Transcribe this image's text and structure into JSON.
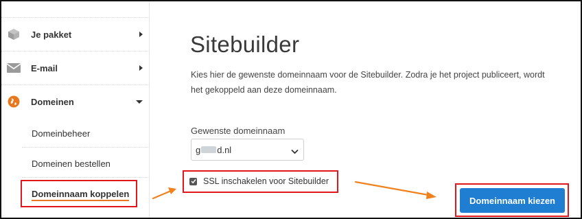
{
  "sidebar": {
    "items": [
      {
        "label": "Je pakket",
        "icon": "package-icon"
      },
      {
        "label": "E-mail",
        "icon": "envelope-icon"
      },
      {
        "label": "Domeinen",
        "icon": "globe-icon"
      }
    ],
    "sub_items": [
      {
        "label": "Domeinbeheer"
      },
      {
        "label": "Domeinen bestellen"
      },
      {
        "label": "Domeinnaam koppelen"
      }
    ]
  },
  "main": {
    "title": "Sitebuilder",
    "description": "Kies hier de gewenste domeinnaam voor de Sitebuilder. Zodra je het project publiceert, wordt het gekoppeld aan deze domeinnaam.",
    "domain_label": "Gewenste domeinnaam",
    "domain_prefix": "g",
    "domain_suffix": "d.nl",
    "ssl_label": "SSL inschakelen voor Sitebuilder",
    "ssl_checked": true,
    "submit_label": "Domeinnaam kiezen"
  },
  "colors": {
    "accent": "#1f7ed1",
    "highlight": "#e0161c",
    "arrow": "#f0821e",
    "globe": "#e8771d"
  }
}
